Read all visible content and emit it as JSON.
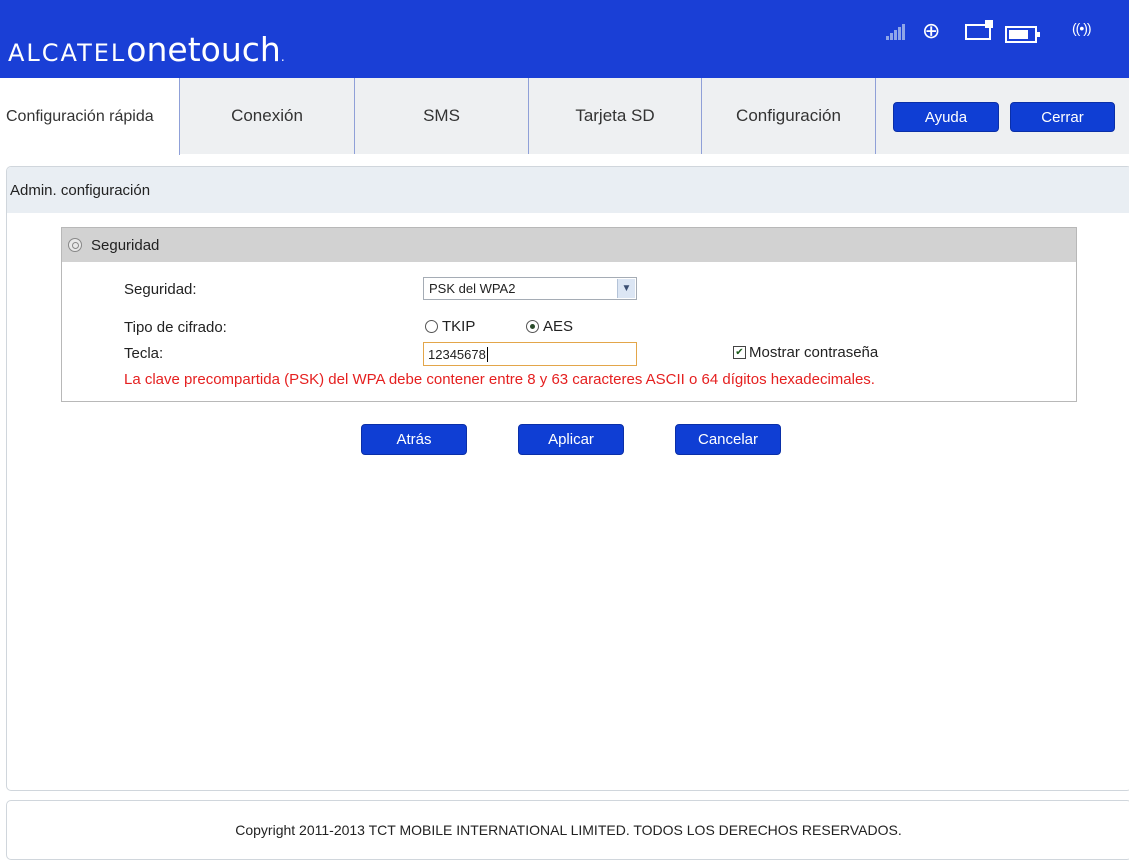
{
  "header": {
    "brand_part1": "ALCATEL",
    "brand_part2": "onetouch",
    "brand_dot": ".",
    "status_icons": [
      "signal-icon",
      "globe-icon",
      "mail-icon",
      "battery-icon",
      "wifi-icon"
    ],
    "wifi_glyph": "((•))",
    "globe_glyph": "⊕",
    "background_color": "#1a3fd6"
  },
  "nav": {
    "tabs": [
      {
        "label": "Configuración rápida"
      },
      {
        "label": "Conexión"
      },
      {
        "label": "SMS"
      },
      {
        "label": "Tarjeta SD"
      },
      {
        "label": "Configuración"
      }
    ],
    "help_label": "Ayuda",
    "close_label": "Cerrar"
  },
  "breadcrumb": {
    "title": "Admin. configuración"
  },
  "security_panel": {
    "header": "Seguridad",
    "security_label": "Seguridad:",
    "security_selected": "PSK del WPA2",
    "cipher_label": "Tipo de cifrado:",
    "cipher_options": [
      {
        "label": "TKIP",
        "selected": false
      },
      {
        "label": "AES",
        "selected": true
      }
    ],
    "key_label": "Tecla:",
    "key_value": "12345678",
    "show_password_label": "Mostrar contraseña",
    "show_password_checked": true,
    "error_message": "La clave precompartida (PSK) del WPA debe contener entre 8 y 63 caracteres ASCII o 64 dígitos hexadecimales.",
    "error_color": "#e52020"
  },
  "actions": {
    "back_label": "Atrás",
    "apply_label": "Aplicar",
    "cancel_label": "Cancelar",
    "button_color": "#0f3ed4"
  },
  "footer": {
    "copyright": "Copyright 2011-2013 TCT MOBILE INTERNATIONAL LIMITED. TODOS LOS DERECHOS RESERVADOS."
  }
}
